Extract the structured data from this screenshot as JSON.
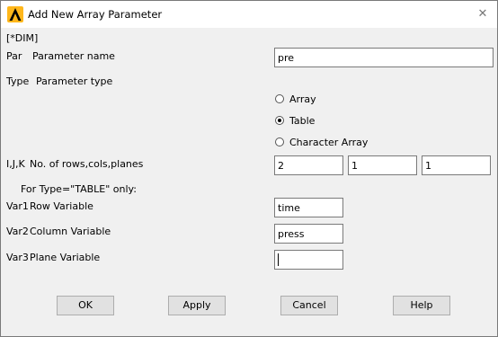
{
  "window": {
    "title": "Add New Array Parameter"
  },
  "command": "[*DIM]",
  "par": {
    "tag": "Par",
    "label": "Parameter name",
    "value": "pre"
  },
  "type": {
    "tag": "Type",
    "label": "Parameter type",
    "options": [
      {
        "label": "Array",
        "checked": false
      },
      {
        "label": "Table",
        "checked": true
      },
      {
        "label": "Character Array",
        "checked": false
      }
    ]
  },
  "ijk": {
    "tag": "I,J,K",
    "label": "No. of rows,cols,planes",
    "values": [
      "2",
      "1",
      "1"
    ]
  },
  "table_note": "For Type=\"TABLE\" only:",
  "var1": {
    "tag": "Var1",
    "label": "Row Variable",
    "value": "time"
  },
  "var2": {
    "tag": "Var2",
    "label": "Column Variable",
    "value": "press"
  },
  "var3": {
    "tag": "Var3",
    "label": "Plane Variable",
    "value": ""
  },
  "buttons": {
    "ok": "OK",
    "apply": "Apply",
    "cancel": "Cancel",
    "help": "Help"
  },
  "close_glyph": "✕"
}
